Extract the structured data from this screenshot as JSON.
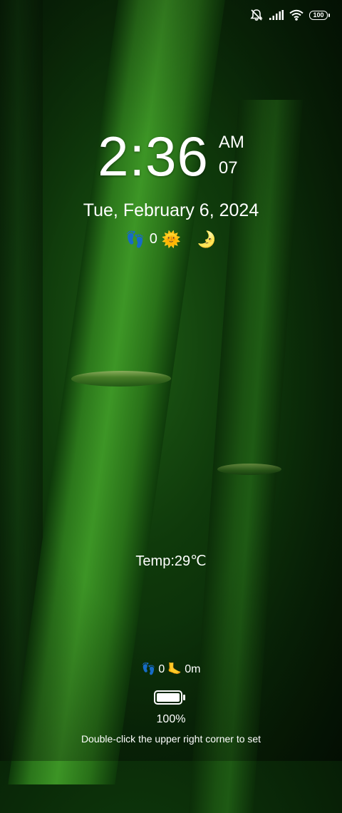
{
  "status_bar": {
    "icons": [
      "mute-notifications-icon",
      "signal-icon",
      "wifi-icon",
      "battery-icon"
    ],
    "battery_level": "100"
  },
  "clock": {
    "time": "2:36",
    "ampm": "AM",
    "seconds": "07"
  },
  "date": "Tue, February 6, 2024",
  "info_row": {
    "steps_emoji": "👣",
    "steps": "0",
    "sun_emoji": "🌞",
    "moon_emoji": "🌛"
  },
  "temperature": "Temp:29℃",
  "activity": {
    "steps_emoji": "👣",
    "steps": "0",
    "distance_emoji": "🦶",
    "distance": "0m"
  },
  "battery": {
    "level_fraction": 1.0,
    "label": "100%"
  },
  "hint": "Double-click the upper right corner to set"
}
